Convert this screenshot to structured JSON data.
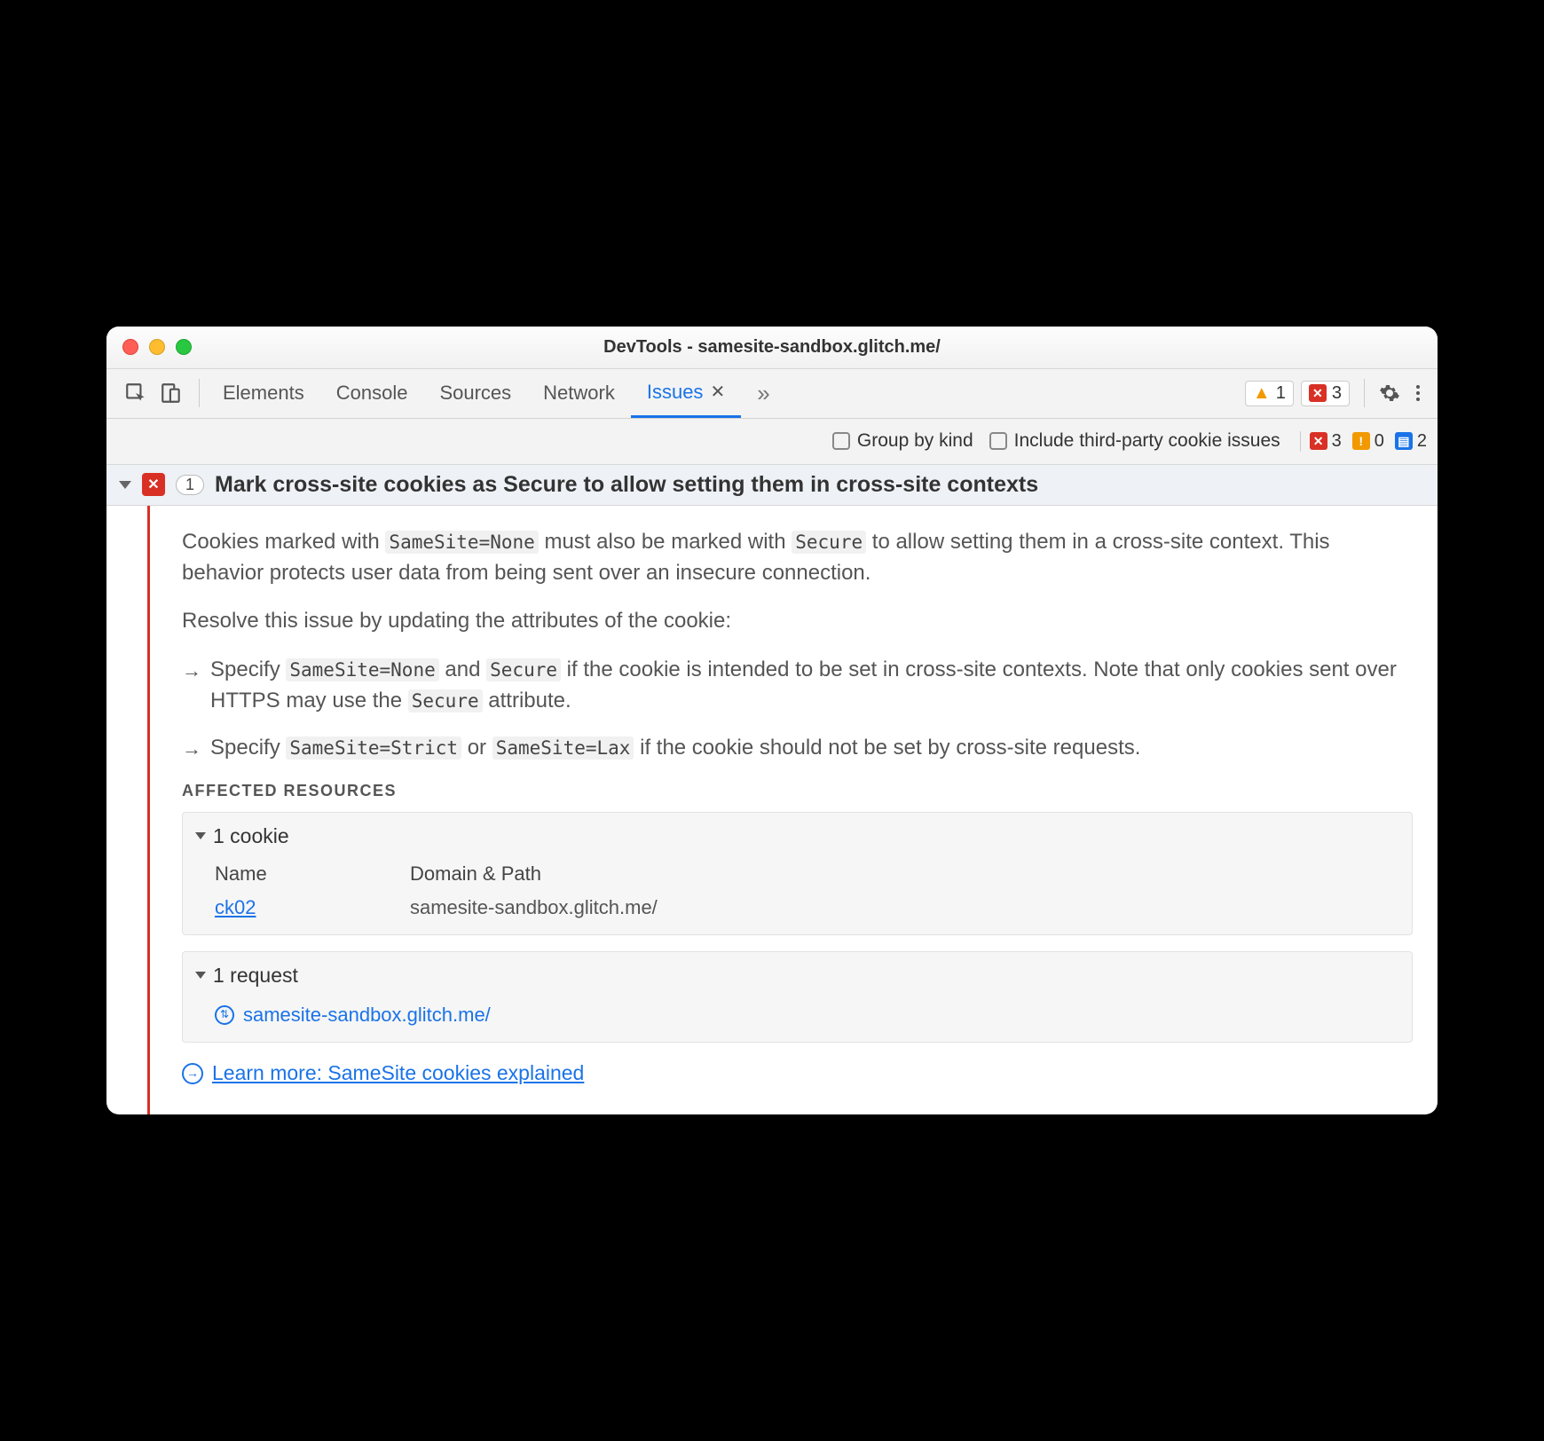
{
  "window": {
    "title": "DevTools - samesite-sandbox.glitch.me/"
  },
  "tabs": {
    "elements": "Elements",
    "console": "Console",
    "sources": "Sources",
    "network": "Network",
    "issues": "Issues"
  },
  "top_badges": {
    "warn_count": "1",
    "err_count": "3"
  },
  "filters": {
    "group_by_kind": "Group by kind",
    "include_third_party": "Include third-party cookie issues"
  },
  "filter_counts": {
    "err": "3",
    "warn": "0",
    "info": "2"
  },
  "issue": {
    "count": "1",
    "title": "Mark cross-site cookies as Secure to allow setting them in cross-site contexts",
    "desc_pre": "Cookies marked with ",
    "desc_code1": "SameSite=None",
    "desc_mid": " must also be marked with ",
    "desc_code2": "Secure",
    "desc_post": " to allow setting them in a cross-site context. This behavior protects user data from being sent over an insecure connection.",
    "resolve": "Resolve this issue by updating the attributes of the cookie:",
    "b1_pre": "Specify ",
    "b1_c1": "SameSite=None",
    "b1_and": " and ",
    "b1_c2": "Secure",
    "b1_post": " if the cookie is intended to be set in cross-site contexts. Note that only cookies sent over HTTPS may use the ",
    "b1_c3": "Secure",
    "b1_tail": " attribute.",
    "b2_pre": "Specify ",
    "b2_c1": "SameSite=Strict",
    "b2_or": " or ",
    "b2_c2": "SameSite=Lax",
    "b2_post": " if the cookie should not be set by cross-site requests."
  },
  "affected": {
    "label": "Affected Resources",
    "cookie_head": "1 cookie",
    "col_name": "Name",
    "col_domain": "Domain & Path",
    "cookie_name": "ck02",
    "cookie_domain": "samesite-sandbox.glitch.me/",
    "request_head": "1 request",
    "request_url": "samesite-sandbox.glitch.me/"
  },
  "learn_more": "Learn more: SameSite cookies explained"
}
